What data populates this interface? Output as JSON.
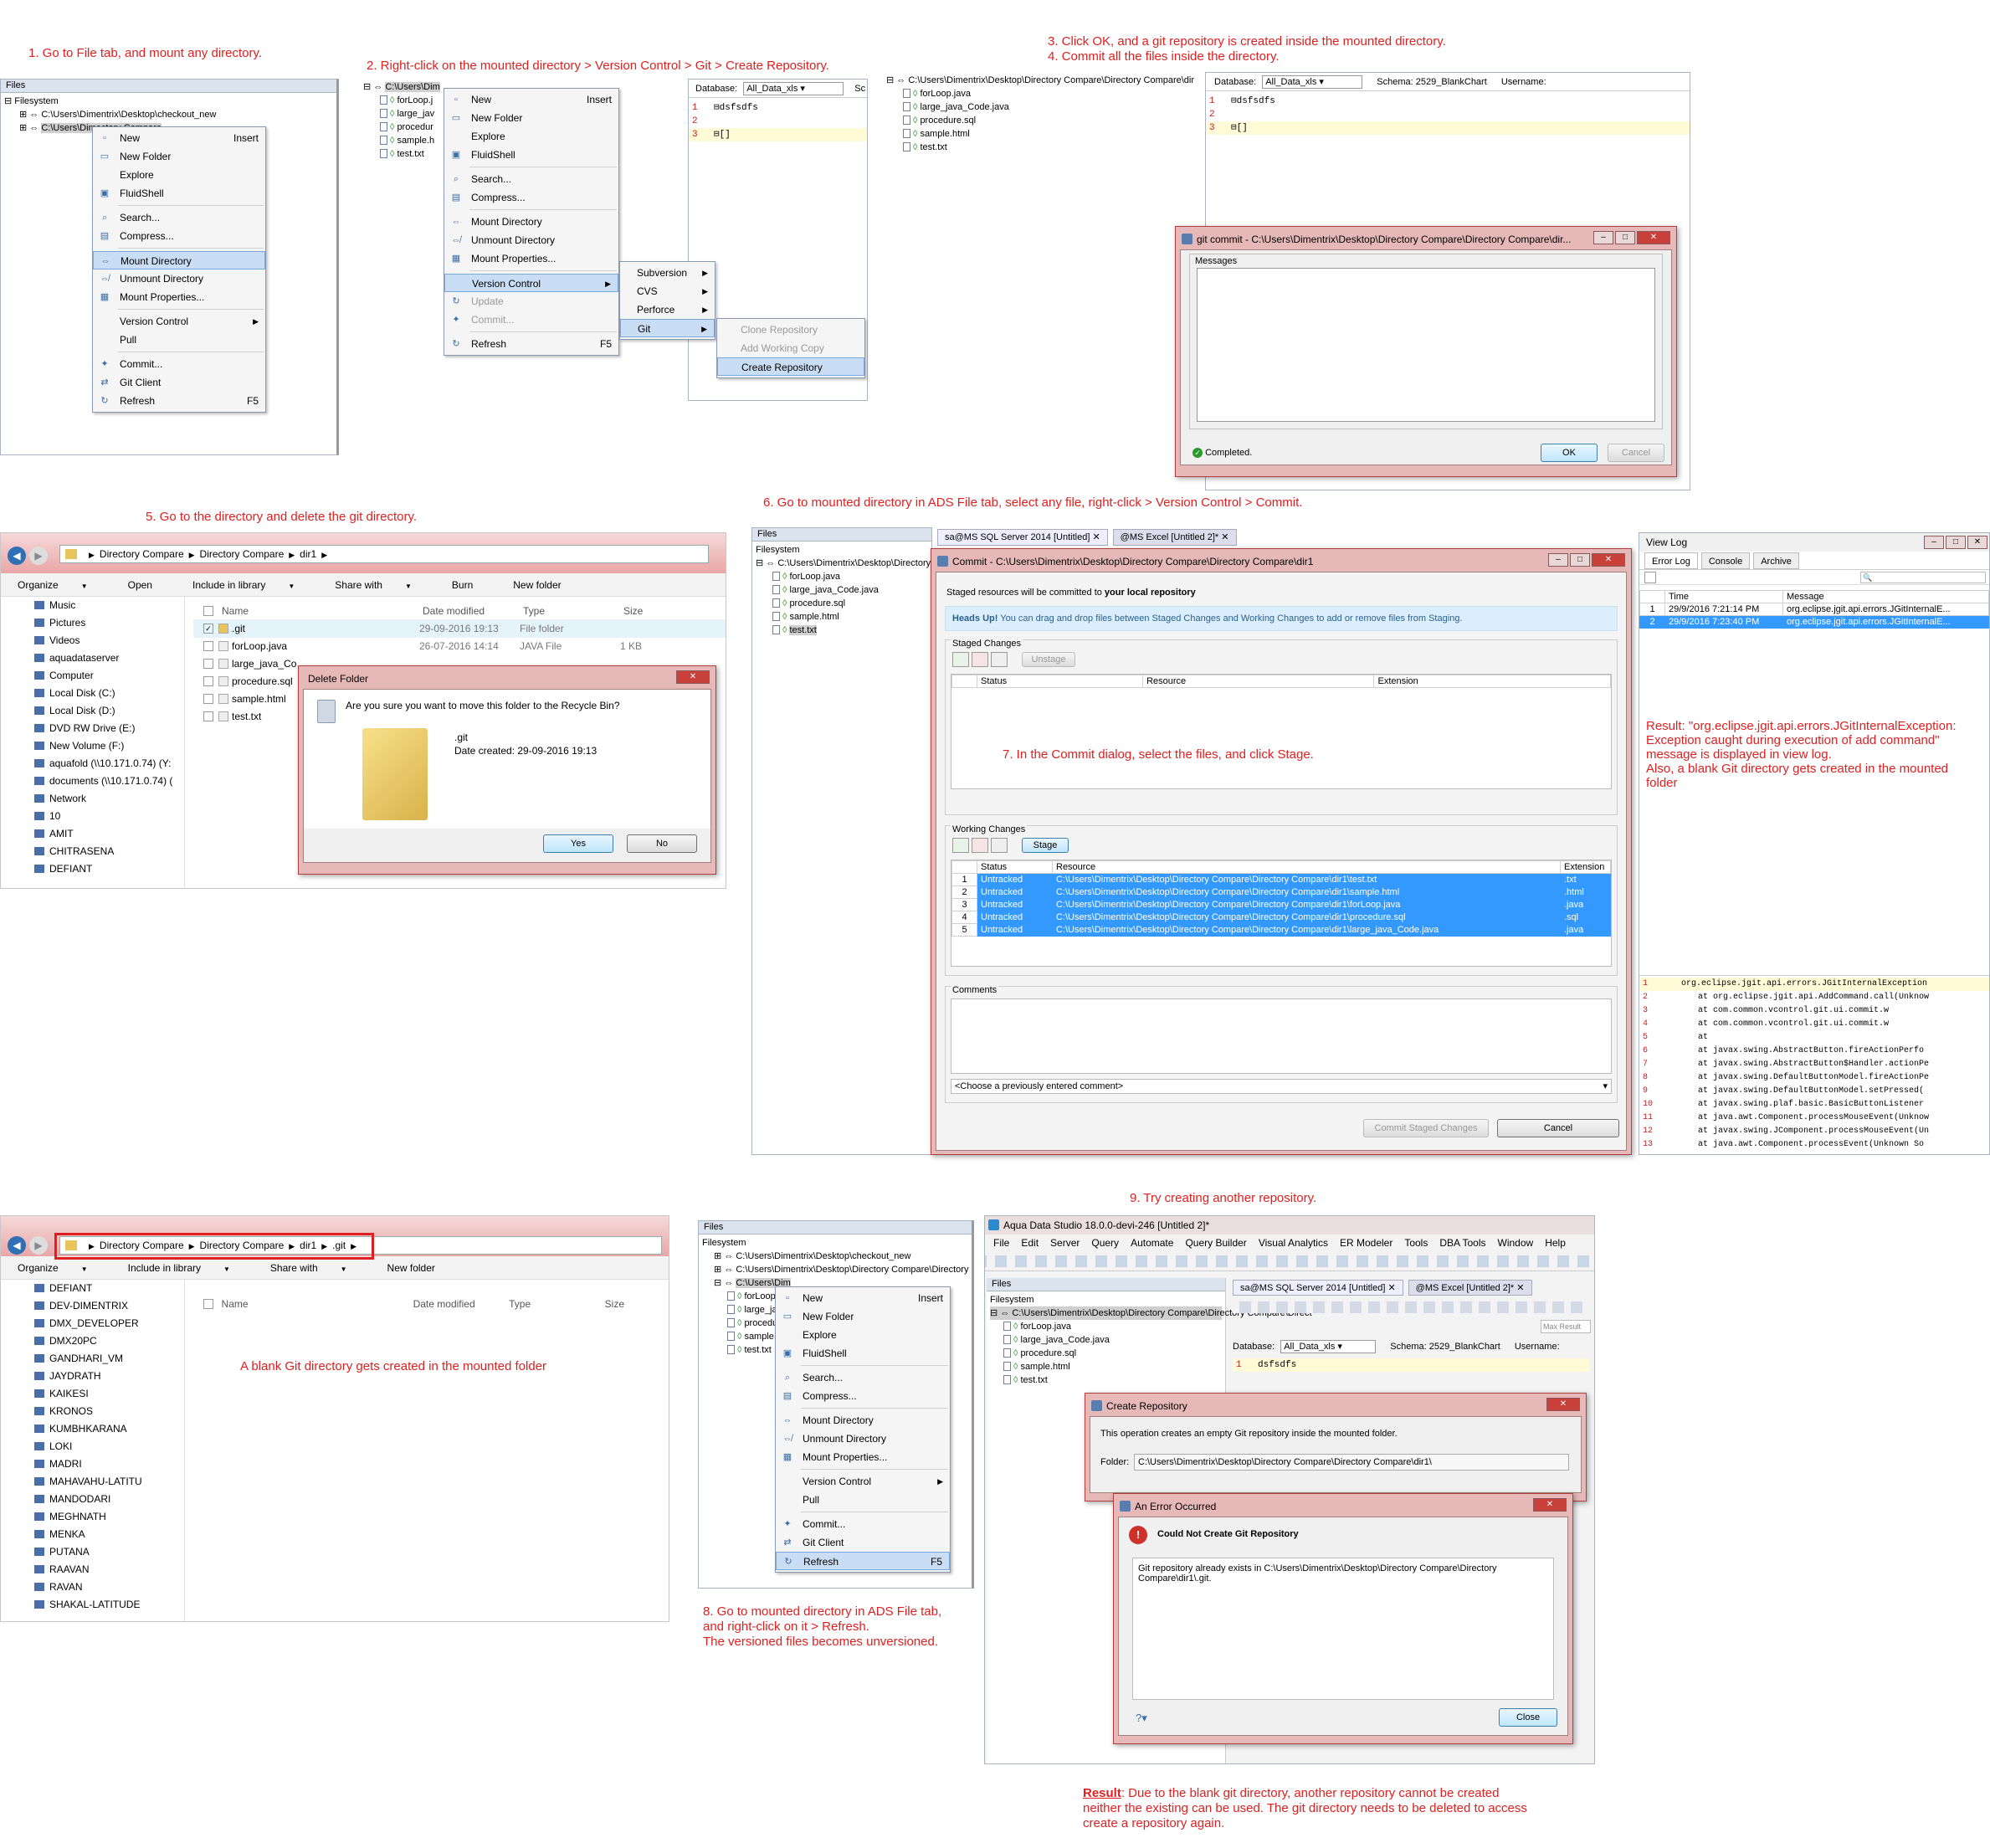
{
  "notes": {
    "step1": "1. Go to File tab, and mount any directory.",
    "step2": "2. Right-click on the mounted directory > Version Control > Git > Create Repository.",
    "step3": "3. Click OK, and a git repository is created inside the mounted directory.",
    "step4": "4. Commit all the files inside the directory.",
    "step5": "5. Go to the directory and delete the git directory.",
    "step6": "6. Go to mounted directory in ADS File tab, select any file, right-click > Version Control > Commit.",
    "step7": "7. In the Commit dialog, select the files, and click Stage.",
    "result_viewlog_1": "Result: \"org.eclipse.jgit.api.errors.JGitInternalException:",
    "result_viewlog_2": "Exception caught during execution of add command\"",
    "result_viewlog_3": "message is displayed in view log.",
    "result_viewlog_4": "Also, a blank Git directory gets created in the mounted",
    "result_viewlog_5": "folder",
    "blank_git": "A blank Git directory gets created in the mounted folder",
    "step8_1": "8. Go to mounted directory in ADS File tab,",
    "step8_2": "and right-click on it > Refresh.",
    "step8_3": "The versioned files becomes unversioned.",
    "step9": "9. Try creating another repository.",
    "final_label": "Result",
    "final_1": ": Due to the blank git directory, another repository cannot be created",
    "final_2": "neither the existing can be used. The git directory needs to be deleted to access",
    "final_3": "create a repository again."
  },
  "files_panel": {
    "title": "Files",
    "filesystem": "Filesystem",
    "path1": "C:\\Users\\Dimentrix\\Desktop\\checkout_new",
    "path2": "C:\\Users\\Dimentrix\\Desktop\\Directory Compare\\Directory Compare\\Direct",
    "path2_short": "C:\\Users\\Dim",
    "path3": "C:\\Users\\Dimentrix\\Desktop\\Directory Compare\\Directory Compare\\dir",
    "path_tail": "ectory Compare",
    "files": [
      "forLoop.java",
      "large_java_Code.java",
      "procedure.sql",
      "sample.html",
      "test.txt"
    ],
    "files_short": [
      "forLoop.j",
      "large_jav",
      "procedur",
      "sample.h",
      "test.txt"
    ]
  },
  "context_menu": {
    "items": [
      {
        "label": "New",
        "shortcut": "Insert",
        "icon": "new-icon"
      },
      {
        "label": "New Folder",
        "icon": "folder-icon"
      },
      {
        "label": "Explore",
        "icon": ""
      },
      {
        "label": "FluidShell",
        "icon": "shell-icon"
      },
      {
        "label": "Search...",
        "icon": "search-icon"
      },
      {
        "label": "Compress...",
        "icon": "compress-icon"
      },
      {
        "label": "Mount Directory",
        "icon": "mount-icon"
      },
      {
        "label": "Unmount Directory",
        "icon": "unmount-icon"
      },
      {
        "label": "Mount Properties...",
        "icon": "properties-icon"
      },
      {
        "label": "Version Control",
        "icon": ""
      },
      {
        "label": "Pull",
        "icon": ""
      },
      {
        "label": "Commit...",
        "icon": "commit-icon"
      },
      {
        "label": "Git Client",
        "icon": "git-icon"
      },
      {
        "label": "Refresh",
        "shortcut": "F5",
        "icon": "refresh-icon"
      }
    ],
    "update": "Update",
    "commit": "Commit...",
    "refresh": "Refresh",
    "refresh_shortcut": "F5"
  },
  "vc_submenu": [
    "Subversion",
    "CVS",
    "Perforce",
    "Git"
  ],
  "git_submenu": [
    "Clone Repository",
    "Add Working Copy",
    "Create Repository"
  ],
  "editor": {
    "database_label": "Database:",
    "database_value": "All_Data_xls",
    "schema_label": "Schema:",
    "schema_value": "2529_BlankChart",
    "username_label": "Username:",
    "sc": "Sc",
    "line1": "dsfsdfs",
    "line3": "[]"
  },
  "git_commit_dialog": {
    "title": "git commit - C:\\Users\\Dimentrix\\Desktop\\Directory Compare\\Directory Compare\\dir...",
    "messages": "Messages",
    "status": "Completed.",
    "ok": "OK",
    "cancel": "Cancel"
  },
  "explorer1": {
    "crumbs": [
      "Directory Compare",
      "Directory Compare",
      "dir1"
    ],
    "commands": [
      "Organize",
      "Open",
      "Include in library",
      "Share with",
      "Burn",
      "New folder"
    ],
    "nav": [
      "Music",
      "Pictures",
      "Videos",
      "aquadataserver",
      "Computer",
      "Local Disk (C:)",
      "Local Disk (D:)",
      "DVD RW Drive (E:)",
      "New Volume (F:)",
      "aquafold (\\\\10.171.0.74) (Y:",
      "documents (\\\\10.171.0.74) (",
      "Network",
      "10",
      "AMIT",
      "CHITRASENA",
      "DEFIANT"
    ],
    "columns": [
      "Name",
      "Date modified",
      "Type",
      "Size"
    ],
    "rows": [
      {
        "name": ".git",
        "date": "29-09-2016 19:13",
        "type": "File folder",
        "size": ""
      },
      {
        "name": "forLoop.java",
        "date": "26-07-2016 14:14",
        "type": "JAVA File",
        "size": "1 KB"
      },
      {
        "name": "large_java_Co",
        "date": "",
        "type": "",
        "size": ""
      },
      {
        "name": "procedure.sql",
        "date": "",
        "type": "",
        "size": ""
      },
      {
        "name": "sample.html",
        "date": "",
        "type": "",
        "size": ""
      },
      {
        "name": "test.txt",
        "date": "",
        "type": "",
        "size": ""
      }
    ]
  },
  "delete_dialog": {
    "title": "Delete Folder",
    "question": "Are you sure you want to move this folder to the Recycle Bin?",
    "name": ".git",
    "created": "Date created: 29-09-2016 19:13",
    "yes": "Yes",
    "no": "No"
  },
  "ads_tabs": {
    "files": "Files",
    "tab1": "sa@MS SQL Server 2014 [Untitled]",
    "tab2": "@MS Excel [Untitled 2]*"
  },
  "commit_dialog": {
    "title": "Commit - C:\\Users\\Dimentrix\\Desktop\\Directory Compare\\Directory Compare\\dir1",
    "staged_info_pre": "Staged resources will be committed to ",
    "staged_info_bold": "your local repository",
    "heads_up_bold": "Heads Up!",
    "heads_up": " You can drag and drop files between Staged Changes and Working Changes to add or remove files from Staging.",
    "staged_changes": "Staged Changes",
    "unstage": "Unstage",
    "working_changes": "Working Changes",
    "stage": "Stage",
    "cols": [
      "Status",
      "Resource",
      "Extension"
    ],
    "rows": [
      {
        "n": "1",
        "status": "Untracked",
        "resource": "C:\\Users\\Dimentrix\\Desktop\\Directory Compare\\Directory Compare\\dir1\\test.txt",
        "ext": ".txt"
      },
      {
        "n": "2",
        "status": "Untracked",
        "resource": "C:\\Users\\Dimentrix\\Desktop\\Directory Compare\\Directory Compare\\dir1\\sample.html",
        "ext": ".html"
      },
      {
        "n": "3",
        "status": "Untracked",
        "resource": "C:\\Users\\Dimentrix\\Desktop\\Directory Compare\\Directory Compare\\dir1\\forLoop.java",
        "ext": ".java"
      },
      {
        "n": "4",
        "status": "Untracked",
        "resource": "C:\\Users\\Dimentrix\\Desktop\\Directory Compare\\Directory Compare\\dir1\\procedure.sql",
        "ext": ".sql"
      },
      {
        "n": "5",
        "status": "Untracked",
        "resource": "C:\\Users\\Dimentrix\\Desktop\\Directory Compare\\Directory Compare\\dir1\\large_java_Code.java",
        "ext": ".java"
      }
    ],
    "comments": "Comments",
    "choose_comment": "<Choose a previously entered comment>",
    "commit_staged": "Commit Staged Changes",
    "cancel": "Cancel"
  },
  "view_log": {
    "title": "View Log",
    "tabs": [
      "Error Log",
      "Console",
      "Archive"
    ],
    "cols": [
      "Time",
      "Message"
    ],
    "rows": [
      {
        "n": "1",
        "time": "29/9/2016 7:21:14 PM",
        "msg": "org.eclipse.jgit.api.errors.JGitInternalE..."
      },
      {
        "n": "2",
        "time": "29/9/2016 7:23:40 PM",
        "msg": "org.eclipse.jgit.api.errors.JGitInternalE..."
      }
    ],
    "trace": [
      "org.eclipse.jgit.api.errors.JGitInternalException",
      "at org.eclipse.jgit.api.AddCommand.call(Unknow",
      "at com.common.vcontrol.git.ui.commit.w",
      "at com.common.vcontrol.git.ui.commit.w",
      "at",
      "at javax.swing.AbstractButton.fireActionPerfo",
      "at javax.swing.AbstractButton$Handler.actionPe",
      "at javax.swing.DefaultButtonModel.fireActionPe",
      "at javax.swing.DefaultButtonModel.setPressed(",
      "at javax.swing.plaf.basic.BasicButtonListener",
      "at java.awt.Component.processMouseEvent(Unknow",
      "at javax.swing.JComponent.processMouseEvent(Un",
      "at java.awt.Component.processEvent(Unknown So"
    ]
  },
  "explorer2": {
    "crumbs": [
      "Directory Compare",
      "Directory Compare",
      "dir1",
      ".git"
    ],
    "commands": [
      "Organize",
      "Include in library",
      "Share with",
      "New folder"
    ],
    "nav": [
      "DEFIANT",
      "DEV-DIMENTRIX",
      "DMX_DEVELOPER",
      "DMX20PC",
      "GANDHARI_VM",
      "JAYDRATH",
      "KAIKESI",
      "KRONOS",
      "KUMBHKARANA",
      "LOKI",
      "MADRI",
      "MAHAVAHU-LATITU",
      "MANDODARI",
      "MEGHNATH",
      "MENKA",
      "PUTANA",
      "RAAVAN",
      "RAVAN",
      "SHAKAL-LATITUDE"
    ],
    "columns": [
      "Name",
      "Date modified",
      "Type",
      "Size"
    ]
  },
  "ads_main": {
    "title": "Aqua Data Studio 18.0.0-devi-246 [Untitled 2]*",
    "menus": [
      "File",
      "Edit",
      "Server",
      "Query",
      "Automate",
      "Query Builder",
      "Visual Analytics",
      "ER Modeler",
      "Tools",
      "DBA Tools",
      "Window",
      "Help"
    ],
    "max_results": "Max Result"
  },
  "create_repo": {
    "title": "Create Repository",
    "desc": "This operation creates an empty Git repository inside the mounted folder.",
    "folder_label": "Folder:",
    "folder_value": "C:\\Users\\Dimentrix\\Desktop\\Directory Compare\\Directory Compare\\dir1\\"
  },
  "error_dialog": {
    "title": "An Error Occurred",
    "heading": "Could Not Create Git Repository",
    "message1": "Git repository already exists in C:\\Users\\Dimentrix\\Desktop\\Directory Compare\\Directory",
    "message2": "Compare\\dir1\\.git.",
    "help": "?",
    "close": "Close"
  }
}
